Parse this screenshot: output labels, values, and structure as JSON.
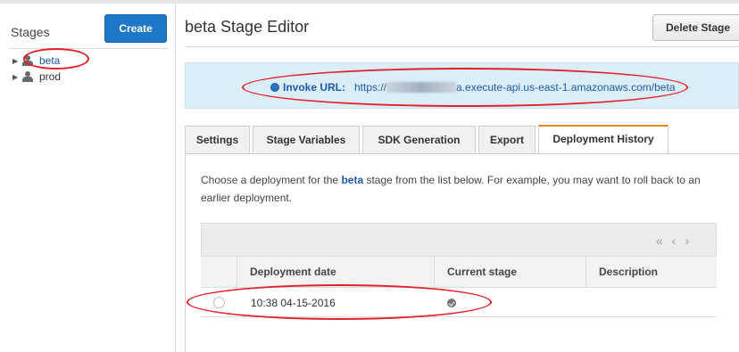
{
  "sidebar": {
    "title": "Stages",
    "create_label": "Create",
    "stages": [
      {
        "label": "beta"
      },
      {
        "label": "prod"
      }
    ]
  },
  "header": {
    "title": "beta Stage Editor",
    "delete_label": "Delete Stage"
  },
  "invoke": {
    "label": "Invoke URL:",
    "url_prefix": "https://",
    "url_suffix": "a.execute-api.us-east-1.amazonaws.com/beta"
  },
  "tabs": [
    {
      "label": "Settings"
    },
    {
      "label": "Stage Variables"
    },
    {
      "label": "SDK Generation"
    },
    {
      "label": "Export"
    },
    {
      "label": "Deployment History",
      "active": true
    }
  ],
  "description": {
    "before": "Choose a deployment for the ",
    "stage": "beta",
    "after": " stage from the list below. For example, you may want to roll back to an earlier deployment."
  },
  "table": {
    "pager": [
      "«",
      "‹",
      "›"
    ],
    "columns": [
      "Deployment date",
      "Current stage",
      "Description"
    ],
    "rows": [
      {
        "date": "10:38 04-15-2016",
        "current_stage_icon": "check-circle-icon",
        "description": ""
      }
    ]
  },
  "colors": {
    "accent_blue": "#1f77c9",
    "active_tab_border": "#e38b1d",
    "annotation_red": "#e3202a",
    "info_box": "#dbeef7"
  }
}
